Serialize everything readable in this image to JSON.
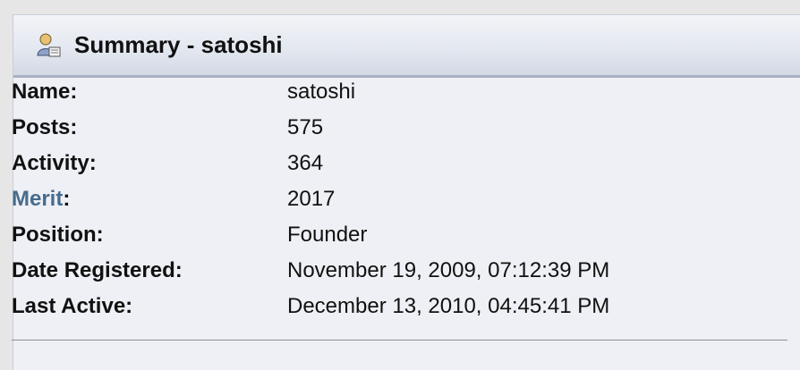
{
  "header": {
    "icon": "user-profile-icon",
    "title": "Summary - satoshi"
  },
  "summary": {
    "name": {
      "label": "Name:",
      "value": "satoshi"
    },
    "posts": {
      "label": "Posts:",
      "value": "575"
    },
    "activity": {
      "label": "Activity:",
      "value": "364"
    },
    "merit": {
      "label": "Merit",
      "colon": ":",
      "value": "2017"
    },
    "position": {
      "label": "Position:",
      "value": "Founder"
    },
    "date_registered": {
      "label": "Date Registered:",
      "value": "November 19, 2009, 07:12:39 PM"
    },
    "last_active": {
      "label": "Last Active:",
      "value": "December 13, 2010, 04:45:41 PM"
    }
  },
  "colors": {
    "link": "#476c8e",
    "panel_bg": "#eef0f5",
    "header_border": "#a7b0c4"
  }
}
